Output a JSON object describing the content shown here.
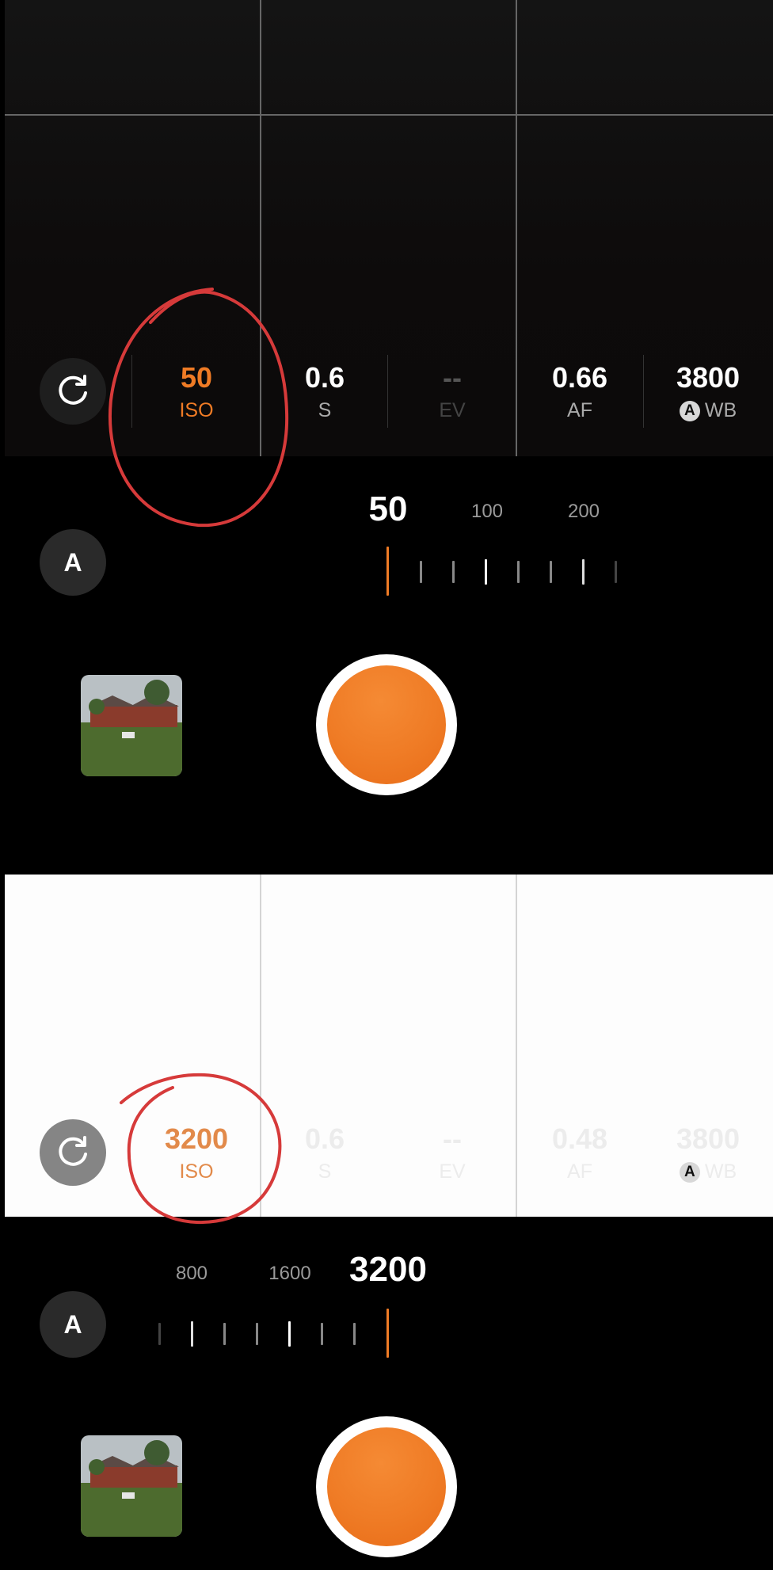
{
  "panels": [
    {
      "params": [
        {
          "value": "50",
          "label": "ISO",
          "state": "active"
        },
        {
          "value": "0.6",
          "label": "S",
          "state": "normal"
        },
        {
          "value": "--",
          "label": "EV",
          "state": "disabled"
        },
        {
          "value": "0.66",
          "label": "AF",
          "state": "normal"
        },
        {
          "value": "3800",
          "label": "WB",
          "badge": "A",
          "state": "normal"
        }
      ],
      "dial": {
        "current": "50",
        "numbers": [
          "100",
          "200"
        ]
      },
      "auto_button": "A"
    },
    {
      "params": [
        {
          "value": "3200",
          "label": "ISO",
          "state": "active"
        },
        {
          "value": "0.6",
          "label": "S",
          "state": "faded"
        },
        {
          "value": "--",
          "label": "EV",
          "state": "faded"
        },
        {
          "value": "0.48",
          "label": "AF",
          "state": "faded"
        },
        {
          "value": "3800",
          "label": "WB",
          "badge": "A",
          "state": "faded"
        }
      ],
      "dial": {
        "current": "3200",
        "numbers": [
          "800",
          "1600"
        ]
      },
      "auto_button": "A"
    }
  ],
  "icons": {
    "reset": "refresh-icon",
    "gallery": "gallery-thumbnail",
    "shutter": "shutter-button"
  },
  "colors": {
    "accent": "#ef7b25",
    "annotation": "#d63a3a",
    "background": "#000000"
  }
}
